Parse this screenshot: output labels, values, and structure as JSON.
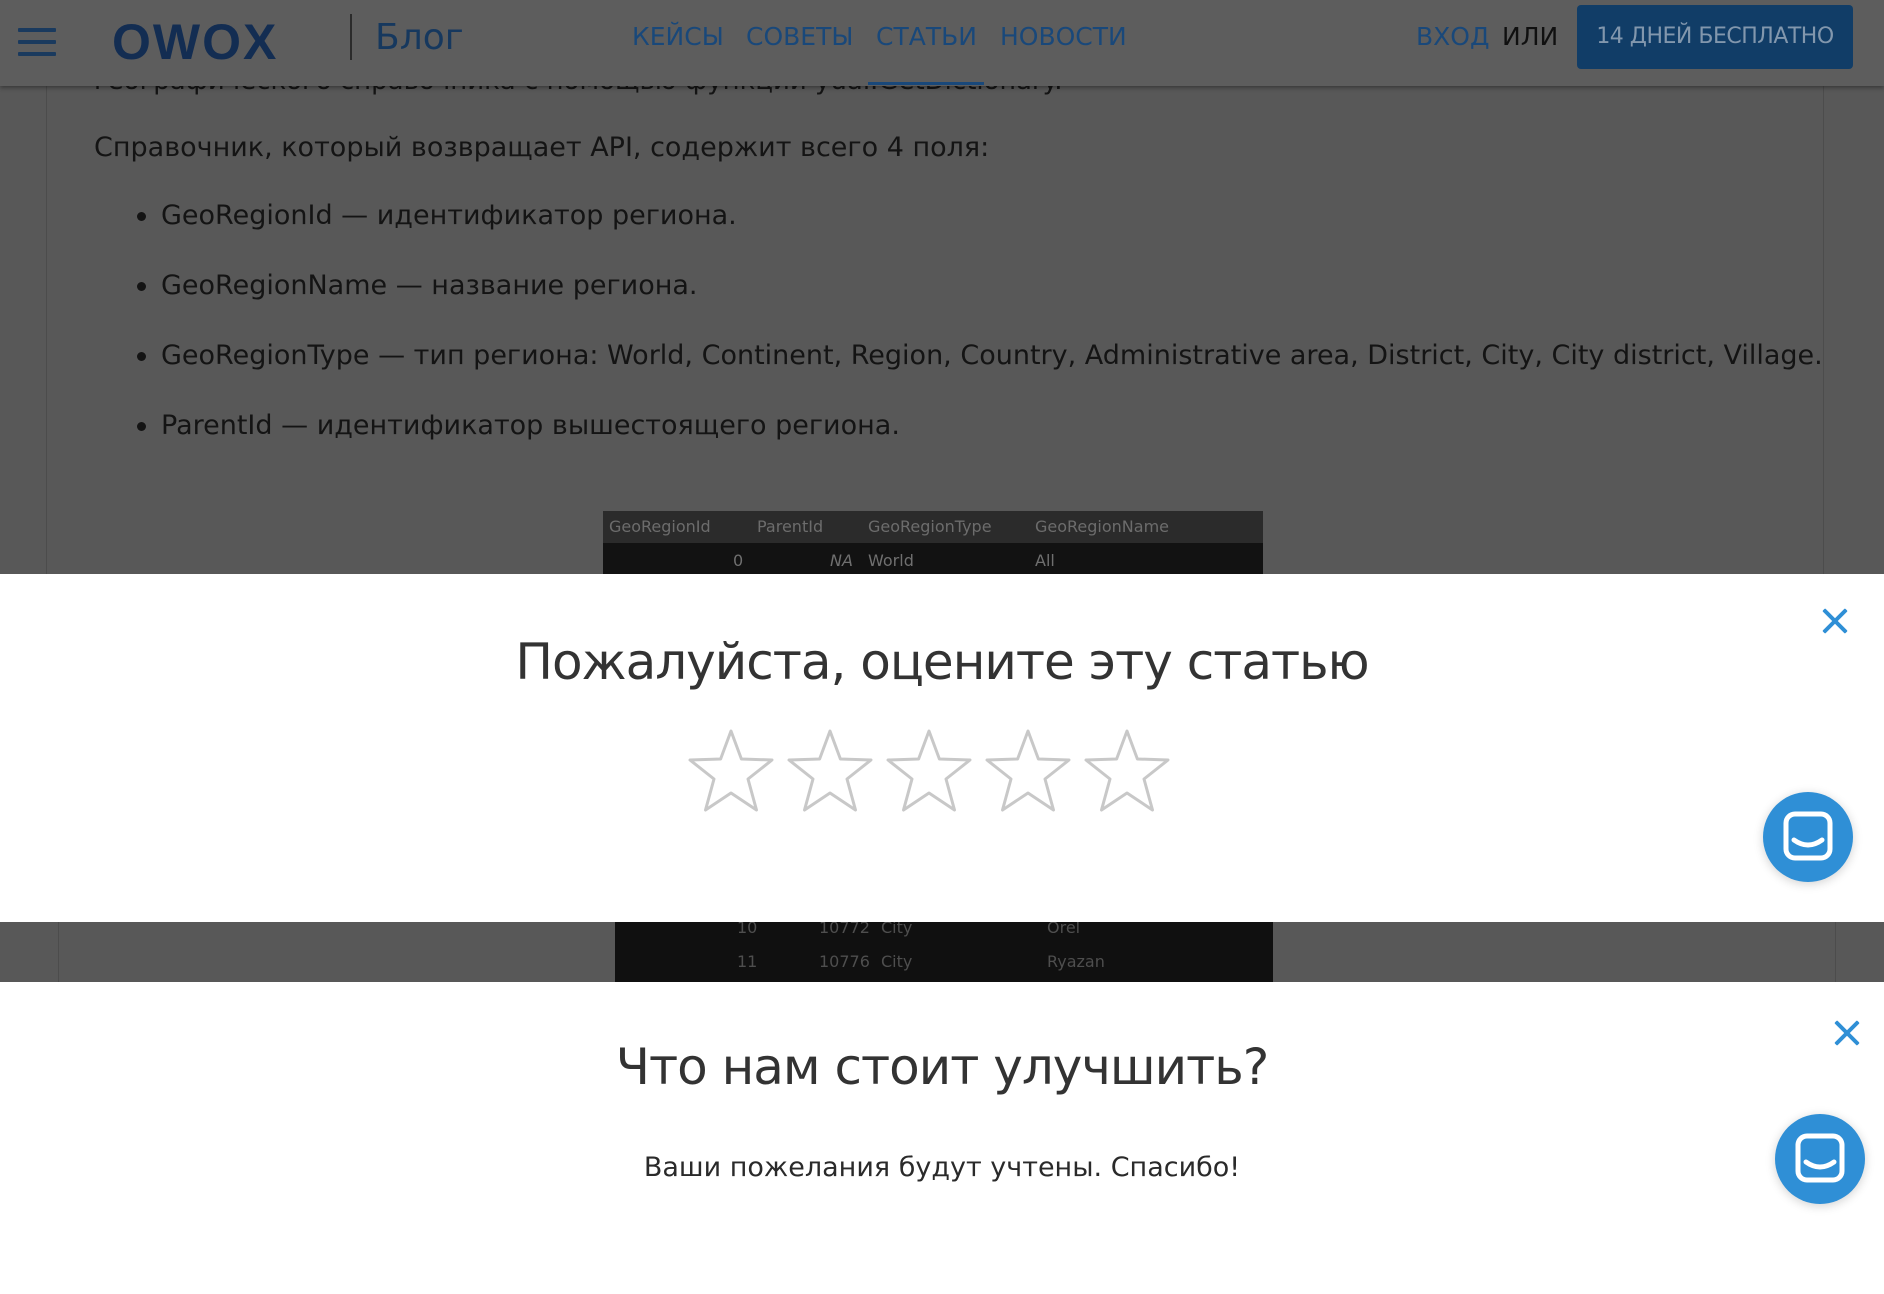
{
  "header": {
    "logo": "OWOX",
    "section": "Блог",
    "nav": [
      "КЕЙСЫ",
      "СОВЕТЫ",
      "СТАТЬИ",
      "НОВОСТИ"
    ],
    "active_nav": "СТАТЬИ",
    "login": "ВХОД",
    "or": "ИЛИ",
    "cta": "14 ДНЕЙ БЕСПЛАТНО"
  },
  "article": {
    "cut_line": "географического справочника с помощью функции yuai.GetDictionary.",
    "intro": "Справочник, который возвращает API, содержит всего 4 поля:",
    "bullets": [
      "GeoRegionId — идентификатор региона.",
      "GeoRegionName — название региона.",
      "GeoRegionType — тип региона: World, Continent, Region, Country, Administrative area, District, City, City district, Village.",
      "ParentId — идентификатор вышестоящего региона."
    ]
  },
  "table_image": {
    "columns": [
      "GeoRegionId",
      "ParentId",
      "GeoRegionType",
      "GeoRegionName"
    ],
    "rows": [
      {
        "id": "0",
        "parent": "NA",
        "type": "World",
        "name": "All"
      },
      {
        "id": "10",
        "parent": "10772",
        "type": "City",
        "name": "Orel"
      },
      {
        "id": "11",
        "parent": "10776",
        "type": "City",
        "name": "Ryazan"
      }
    ]
  },
  "rating_modal": {
    "title": "Пожалуйста, оцените эту статью",
    "stars_total": 5,
    "stars_selected": 0
  },
  "improve_modal": {
    "title": "Что нам стоит улучшить?",
    "note": "Ваши пожелания будут учтены. Спасибо!"
  },
  "colors": {
    "brand": "#1b5da0",
    "accent": "#2f8fd6",
    "overlay": "#585858",
    "star_outline": "#c8c8c8"
  },
  "icons": [
    "menu-icon",
    "close-icon",
    "star-icon",
    "chat-icon"
  ]
}
